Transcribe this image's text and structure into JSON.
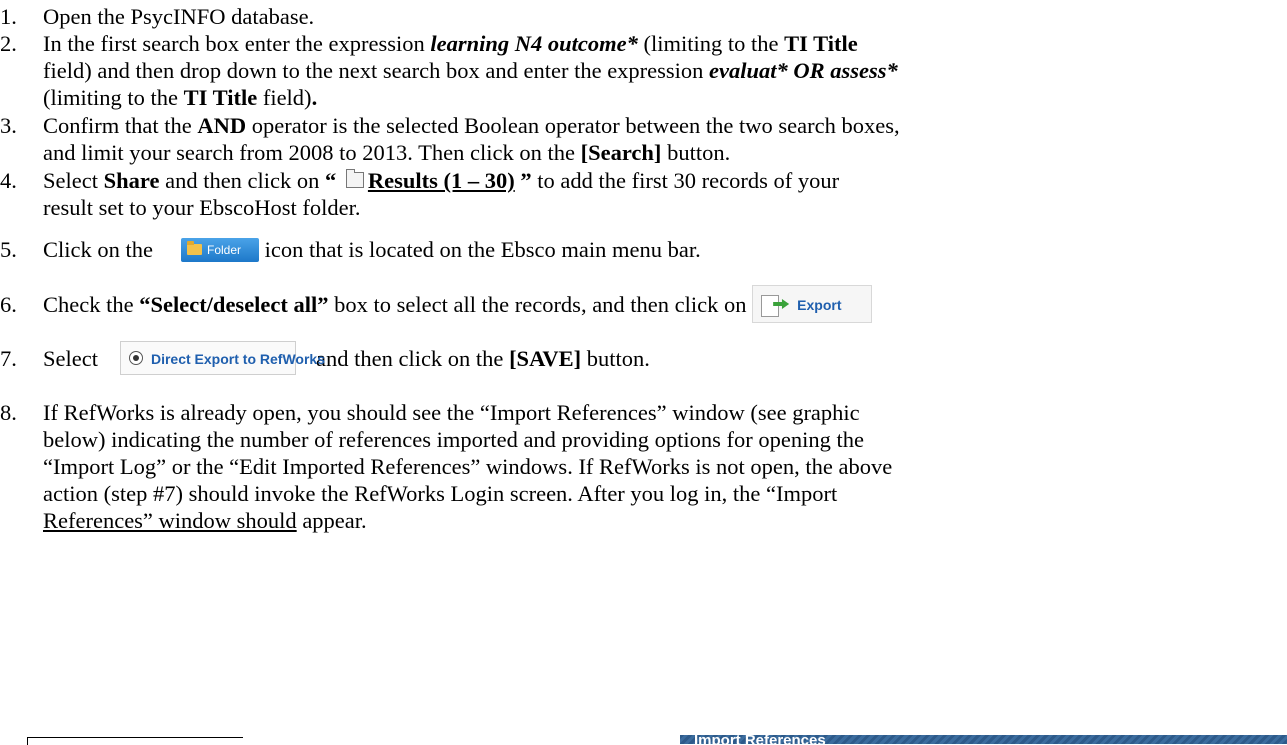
{
  "steps": [
    {
      "n": "1.",
      "text": "Open the PsycINFO database."
    },
    {
      "n": "2.",
      "a": "In the first search box enter the expression ",
      "b_learn": "learning N4 outcome*",
      "c": " (limiting to the ",
      "d_ti": "TI Title",
      "e_line2": "field) and then drop down to the next search box and enter the expression ",
      "f_eval": "evaluat* OR assess*",
      "g_line3": "(limiting to the ",
      "h_ti": "TI Title",
      "i": " field)",
      "j_dot": "."
    },
    {
      "n": "3.",
      "a": "Confirm that the ",
      "b_and": "AND",
      "c": " operator is the selected Boolean operator between the two search boxes,",
      "d_line2": "and limit your search from 2008 to 2013.  Then click on the ",
      "e_search": "[Search]",
      "f": " button."
    },
    {
      "n": "4.",
      "a": "Select ",
      "b_share": "Share",
      "c": " and then click on ",
      "d_q1": "“",
      "e_results": "Results (1 – 30)",
      "f_q2": " ”",
      "g": " to add the first 30 records of your",
      "h_line2": "result set to your EbscoHost folder."
    },
    {
      "n": "5.",
      "a": "Click on the",
      "btn": "Folder",
      "b": " icon that is located on the Ebsco main menu bar."
    },
    {
      "n": "6.",
      "a": "Check the ",
      "b_sel": "“Select/deselect all”",
      "c": " box to select all the records, and then click on",
      "btn": "Export"
    },
    {
      "n": "7.",
      "a": "Select",
      "btn": "Direct Export to RefWorks",
      "b": "and then click on the ",
      "c_save": "[SAVE]",
      "d": " button."
    },
    {
      "n": "8.",
      "l1": "If RefWorks is already open, you should see the “Import References” window (see graphic",
      "l2": "below) indicating the number of references imported and providing options for opening the",
      "l3": "“Import Log” or the “Edit Imported References” windows.   If RefWorks is not open, the above",
      "l4": "action (step #7) should invoke the RefWorks Login screen.  After you log in, the “Import",
      "l5a": "References” window should",
      "l5b": " appear."
    }
  ],
  "import_window": {
    "title": "Import References"
  },
  "colors": {
    "ebsco_blue": "#1d78c9",
    "link_blue": "#1f5fae",
    "header_blue": "#2d5a8a"
  },
  "icons": [
    "folder-icon",
    "export-icon",
    "radio-selected-icon"
  ]
}
